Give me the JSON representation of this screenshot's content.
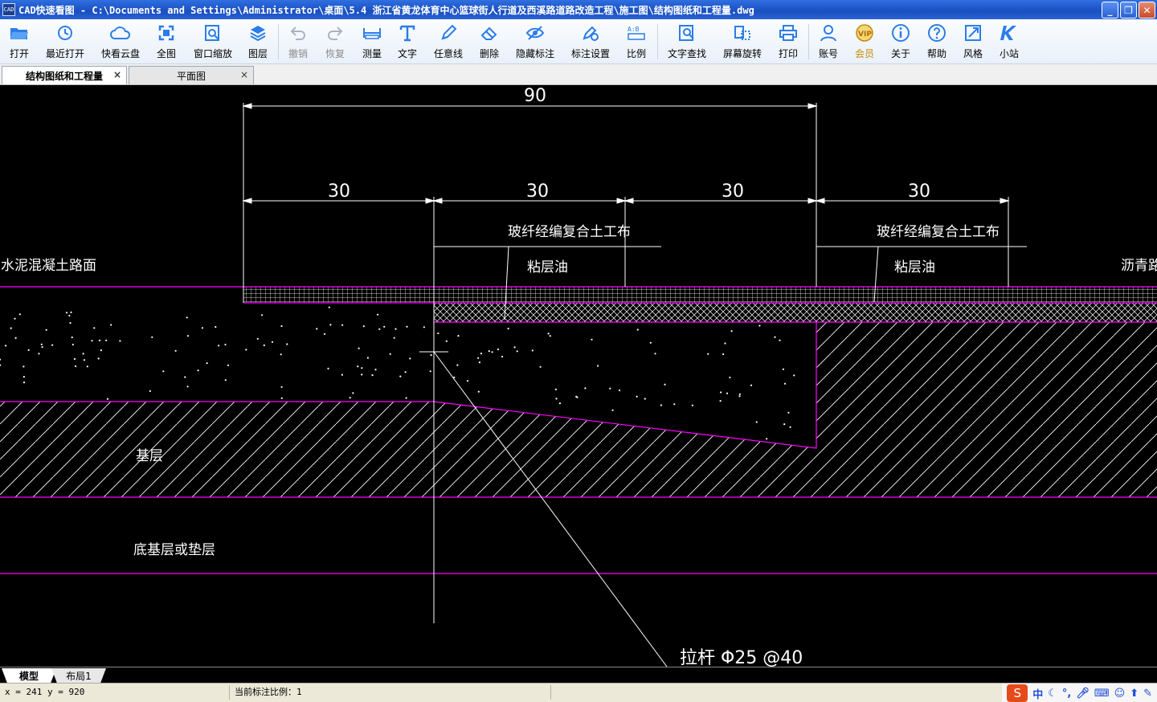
{
  "window": {
    "title": "CAD快速看图 - C:\\Documents and Settings\\Administrator\\桌面\\5.4 浙江省黄龙体育中心篮球街人行道及西溪路道路改造工程\\施工图\\结构图纸和工程量.dwg",
    "icon_text": "CAD"
  },
  "toolbar": {
    "open": "打开",
    "recent": "最近打开",
    "cloud": "快看云盘",
    "full": "全图",
    "zoom_window": "窗口缩放",
    "layers": "图层",
    "undo": "撤销",
    "redo": "恢复",
    "measure": "测量",
    "text": "文字",
    "freehand": "任意线",
    "delete": "删除",
    "hide_marks": "隐藏标注",
    "mark_settings": "标注设置",
    "scale": "比例",
    "find_text": "文字查找",
    "rotate_screen": "屏幕旋转",
    "print": "打印",
    "account": "账号",
    "member": "会员",
    "about": "关于",
    "help": "帮助",
    "style": "风格",
    "station": "小站"
  },
  "tabs": {
    "tab1": "结构图纸和工程量",
    "tab2": "平面图",
    "close": "×"
  },
  "drawing": {
    "dim_total": "90",
    "dim_1": "30",
    "dim_2": "30",
    "dim_3": "30",
    "dim_4": "30",
    "label_left_surface": "水泥混凝土路面",
    "label_right_surface": "沥青路面",
    "label_geotextile_1": "玻纤经编复合土工布",
    "label_geotextile_2": "玻纤经编复合土工布",
    "label_tack_1": "粘层油",
    "label_tack_2": "粘层油",
    "label_base": "基层",
    "label_subbase": "底基层或垫层",
    "label_tie_bar": "拉杆 Φ25 @40"
  },
  "layout_tabs": {
    "model": "模型",
    "layout1": "布局1"
  },
  "status": {
    "coords": "x = 241 y = 920",
    "scale": "当前标注比例：1"
  },
  "ime": {
    "logo": "S",
    "mode": "中"
  },
  "colors": {
    "canvas": "#000000",
    "lines": "#ffffff",
    "magenta": "#ff00ff"
  }
}
